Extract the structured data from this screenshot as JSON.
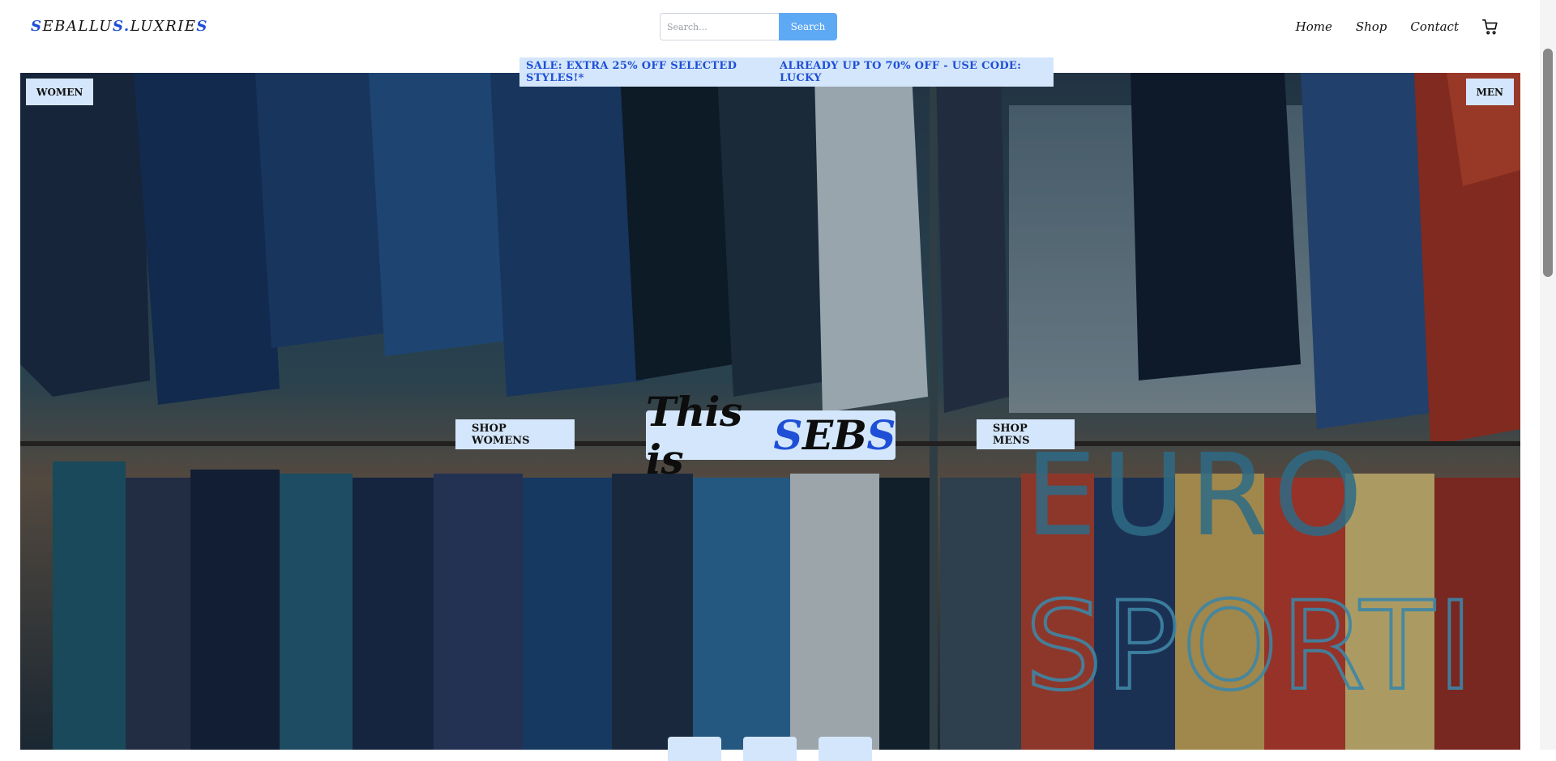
{
  "header": {
    "logo": {
      "s1": "S",
      "mid1": "EBALLU",
      "s2": "S",
      "dot": ".",
      "mid2": "LUXRIE",
      "s3": "S"
    },
    "search": {
      "placeholder": "Search...",
      "button_label": "Search"
    },
    "nav": [
      {
        "label": "Home"
      },
      {
        "label": "Shop"
      },
      {
        "label": "Contact"
      }
    ],
    "cart_icon": "cart-icon"
  },
  "sale_banner": {
    "left_text": "SALE: EXTRA 25% OFF SELECTED STYLES!*",
    "right_text": "ALREADY UP TO 70% OFF - USE CODE: LUCKY"
  },
  "hero": {
    "tag_women": "WOMEN",
    "tag_men": "MEN",
    "shop_womens": "SHOP WOMENS",
    "shop_mens": "SHOP MENS",
    "headline": {
      "prefix": "This is ",
      "s1": "S",
      "mid": "EB",
      "s2": "S"
    },
    "mural_line1": "EURO",
    "mural_line2": "SPORTI"
  },
  "colors": {
    "accent": "#1e4fd6",
    "banner_bg": "#d4e6fb",
    "search_button": "#5ea9f4"
  }
}
